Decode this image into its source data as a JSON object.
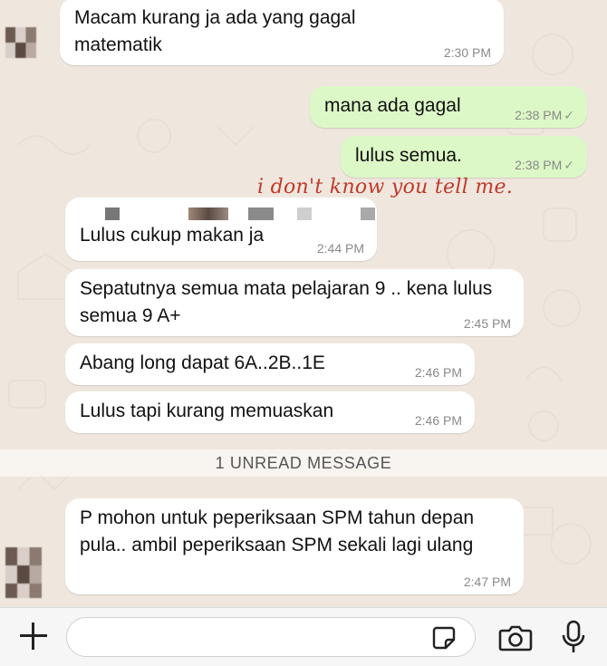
{
  "messages": [
    {
      "text": "Macam kurang ja ada yang gagal matematik",
      "time": "2:30 PM"
    },
    {
      "text": "mana ada gagal",
      "time": "2:38 PM",
      "status": "✓"
    },
    {
      "text": "lulus semua.",
      "time": "2:38 PM",
      "status": "✓"
    },
    {
      "text": "Lulus cukup makan ja",
      "time": "2:44 PM"
    },
    {
      "text": "Sepatutnya semua mata pelajaran 9 .. kena lulus semua 9 A+",
      "time": "2:45 PM"
    },
    {
      "text": "Abang long dapat 6A..2B..1E",
      "time": "2:46 PM"
    },
    {
      "text": "Lulus tapi kurang memuaskan",
      "time": "2:46 PM"
    },
    {
      "text": "P mohon untuk peperiksaan SPM tahun depan pula.. ambil peperiksaan SPM sekali lagi ulang",
      "time": "2:47 PM"
    }
  ],
  "caption": "i don't know you tell me.",
  "unread_banner": "1 UNREAD MESSAGE",
  "composer": {
    "placeholder": "",
    "icons": [
      "plus-icon",
      "sticker-icon",
      "camera-icon",
      "microphone-icon"
    ]
  },
  "colors": {
    "background": "#efe7de",
    "incoming": "#ffffff",
    "outgoing": "#dcf8c6",
    "caption": "#c0392b"
  }
}
